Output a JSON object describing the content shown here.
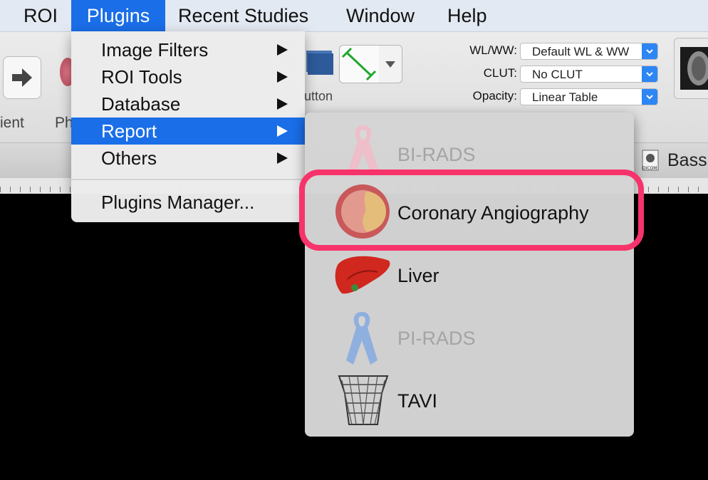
{
  "menubar": {
    "items": [
      "ROI",
      "Plugins",
      "Recent Studies",
      "Window",
      "Help"
    ],
    "active": "Plugins"
  },
  "toolbar": {
    "left_label": "ient",
    "second_label": "Ph",
    "button_fragment": "utton",
    "wlww_label": "WL/WW:",
    "wlww_value": "Default WL & WW",
    "clut_label": "CLUT:",
    "clut_value": "No CLUT",
    "opacity_label": "Opacity:",
    "opacity_value": "Linear Table",
    "tab_label": "Bass",
    "dicom_badge": "DICOM"
  },
  "plugins_menu": {
    "items": [
      {
        "label": "Image Filters",
        "submenu": true
      },
      {
        "label": "ROI Tools",
        "submenu": true
      },
      {
        "label": "Database",
        "submenu": true
      },
      {
        "label": "Report",
        "submenu": true,
        "selected": true
      },
      {
        "label": "Others",
        "submenu": true
      }
    ],
    "manager": "Plugins Manager..."
  },
  "report_submenu": {
    "items": [
      {
        "label": "BI-RADS",
        "enabled": false,
        "icon": "pink-ribbon-icon"
      },
      {
        "label": "Coronary Angiography",
        "enabled": true,
        "icon": "coronary-artery-icon",
        "highlighted": true
      },
      {
        "label": "Liver",
        "enabled": true,
        "icon": "liver-icon"
      },
      {
        "label": "PI-RADS",
        "enabled": false,
        "icon": "blue-ribbon-icon"
      },
      {
        "label": "TAVI",
        "enabled": true,
        "icon": "tavi-valve-icon"
      }
    ]
  },
  "colors": {
    "menu_selection": "#1a6ee8",
    "highlight_ring": "#f7336b",
    "menubar_bg": "#e3e9f2"
  }
}
